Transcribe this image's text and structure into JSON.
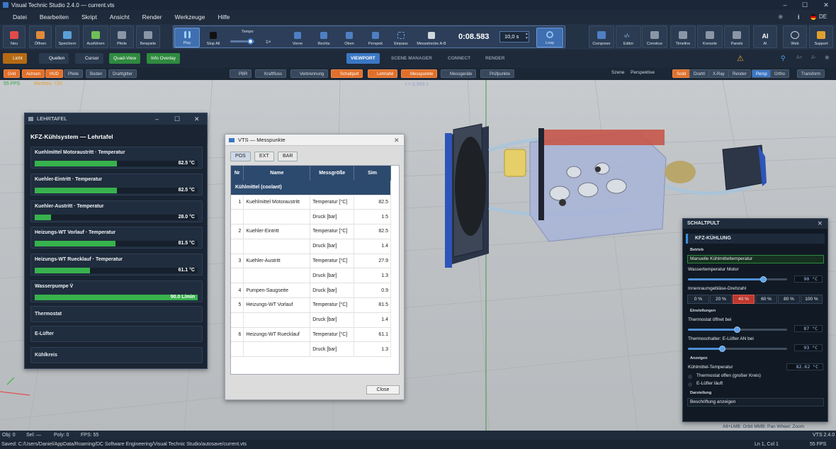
{
  "window": {
    "title": "Visual Technic Studio 2.4.0 — current.vts"
  },
  "menu": [
    "Datei",
    "Bearbeiten",
    "Skript",
    "Ansicht",
    "Render",
    "Werkzeuge",
    "Hilfe"
  ],
  "menu_right": {
    "lang": "DE"
  },
  "toolbar": {
    "file": [
      "Neu",
      "Öffnen",
      "Speichern",
      "Ausführen",
      "Pfeile",
      "Beispiele"
    ],
    "transport": {
      "play": "Play",
      "stop": "Stop All",
      "tempo_label": "Tempo",
      "tempo_value": "1×",
      "views": [
        "Vorne",
        "Rechts",
        "Oben",
        "Perspek",
        "Einpass",
        "Messstrecke A-B"
      ],
      "time": "0:08.583",
      "duration": "10,0 s",
      "loop": "Loop"
    },
    "right": [
      "Composer",
      "Editor",
      "Construx",
      "Timeline",
      "Konsole",
      "Panels",
      "AI",
      "Web",
      "Support"
    ]
  },
  "modebar": {
    "left": [
      "Licht",
      "Quellen",
      "Cursor",
      "Quad-View",
      "Info Overlay"
    ],
    "center": [
      "VIEWPORT",
      "SCENE MANAGER",
      "CONNECT",
      "RENDER"
    ],
    "ai_icon": "AI"
  },
  "subbar": {
    "left": [
      "Grid",
      "Achsen",
      "HUD",
      "Pfeile",
      "Boden",
      "Drahtgitter"
    ],
    "center": [
      "PBR",
      "Kraftfluss",
      "Verbrennung",
      "Schaltpult",
      "Lehrtafel",
      "Messpunkte",
      "Messgeräte",
      "Prüfpunkte"
    ],
    "right_labels": [
      "Szene",
      "Perspektive"
    ],
    "right": [
      "Solid",
      "Drahtl",
      "X-Ray",
      "Render",
      "Persp",
      "Ortho",
      "Transform"
    ]
  },
  "viewport": {
    "fps": "55 FPS",
    "meshes": "Meshes: 720",
    "time_overlay": "t = 8,583 s"
  },
  "lehrtafel": {
    "window_title": "LEHRTAFEL",
    "heading": "KFZ-Kühlsystem — Lehrtafel",
    "gauges": [
      {
        "label": "Kuehlmittel Motoraustritt · Temperatur",
        "value": "82.5 °C",
        "fill": 0.71
      },
      {
        "label": "Kuehler-Eintritt · Temperatur",
        "value": "82.5 °C",
        "fill": 0.71
      },
      {
        "label": "Kuehler-Austritt · Temperatur",
        "value": "28.0 °C",
        "fill": 0.14
      },
      {
        "label": "Heizungs-WT Vorlauf · Temperatur",
        "value": "81.5 °C",
        "fill": 0.7
      },
      {
        "label": "Heizungs-WT Ruecklauf · Temperatur",
        "value": "61.1 °C",
        "fill": 0.48
      },
      {
        "label": "Wasserpumpe V̇",
        "value": "90.0 L/min",
        "fill": 1.0
      }
    ],
    "sections": [
      "Thermostat",
      "E-Lüfter",
      "Kühlkreis"
    ]
  },
  "messpunkte": {
    "window_title": "VTS — Messpunkte",
    "tabs": [
      "POS",
      "EXT",
      "BAR"
    ],
    "headers": [
      "Nr",
      "Name",
      "Messgröße",
      "Sim"
    ],
    "group": "Kühlmittel   (coolant)",
    "rows": [
      {
        "nr": "1",
        "name": "Kuehlmittel Motoraustritt",
        "quantity": "Temperatur [°C]",
        "sim": "82.5"
      },
      {
        "nr": "",
        "name": "",
        "quantity": "Druck [bar]",
        "sim": "1.5"
      },
      {
        "nr": "2",
        "name": "Kuehler-Eintritt",
        "quantity": "Temperatur [°C]",
        "sim": "82.5"
      },
      {
        "nr": "",
        "name": "",
        "quantity": "Druck [bar]",
        "sim": "1.4"
      },
      {
        "nr": "3",
        "name": "Kuehler-Austritt",
        "quantity": "Temperatur [°C]",
        "sim": "27.9"
      },
      {
        "nr": "",
        "name": "",
        "quantity": "Druck [bar]",
        "sim": "1.3"
      },
      {
        "nr": "4",
        "name": "Pumpen-Saugseite",
        "quantity": "Druck [bar]",
        "sim": "0.9"
      },
      {
        "nr": "5",
        "name": "Heizungs-WT Vorlauf",
        "quantity": "Temperatur [°C]",
        "sim": "81.5"
      },
      {
        "nr": "",
        "name": "",
        "quantity": "Druck [bar]",
        "sim": "1.4"
      },
      {
        "nr": "6",
        "name": "Heizungs-WT Ruecklauf",
        "quantity": "Temperatur [°C]",
        "sim": "61.1"
      },
      {
        "nr": "",
        "name": "",
        "quantity": "Druck [bar]",
        "sim": "1.3"
      }
    ],
    "close": "Close"
  },
  "schaltpult": {
    "window_title": "SCHALTPULT",
    "heading": "KFZ-KÜHLUNG",
    "betrieb": "Betrieb",
    "mode": "Manuelle Kühlmitteltemperatur",
    "motor_temp_label": "Wassertemperatur Motor",
    "motor_temp_value": "90 °C",
    "motor_temp_level": 0.76,
    "blower_label": "Innenraumgebläse-Drehzahl",
    "blower_options": [
      "0 %",
      "20 %",
      "40 %",
      "60 %",
      "80 %",
      "100 %"
    ],
    "blower_selected": "40 %",
    "einstellungen": "Einstellungen",
    "thermostat_label": "Thermostat öffnet bei",
    "thermostat_value": "87 °C",
    "thermostat_level": 0.49,
    "fan_label": "Thermoschalter: E-Lüfter AN bei",
    "fan_value": "93 °C",
    "fan_level": 0.34,
    "anzeigen": "Anzeigen",
    "coolant_label": "Kühlmittel-Temperatur",
    "coolant_value": "82.62 °C",
    "ind_thermostat": "Thermostat offen (großer Kreis)",
    "ind_fan": "E-Lüfter läuft",
    "darstellung": "Darstellung",
    "labels_btn": "Beschriftung anzeigen"
  },
  "status": {
    "obj": "Obj: 0",
    "sel": "Sel: —",
    "poly": "Poly: 0",
    "fps": "FPS: 55",
    "hint": "Alt+LMB: Orbit   MMB: Pan   Wheel: Zoom",
    "version": "VTS 2.4.0",
    "saved": "Saved: C:/Users/Daniel/AppData/Roaming/DC Software Engineering/Visual Technic Studio/autosave/current.vts",
    "cursor": "Ln 1, Col 1",
    "fps2": "55 FPS"
  },
  "colors": {
    "accent": "#3b77c4",
    "active_orange": "#e0702b",
    "gauge_green": "#37b24d",
    "table_header": "#2c4a6e",
    "selected_red": "#c0362c"
  }
}
